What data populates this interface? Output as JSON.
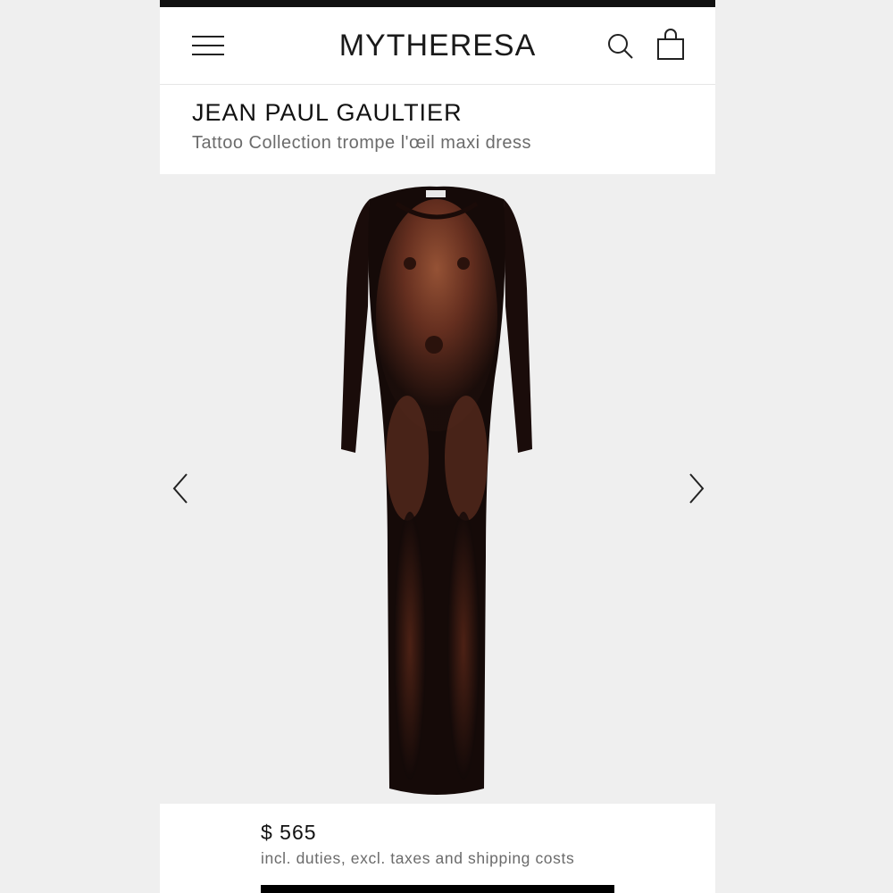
{
  "header": {
    "logo": "MYTHERESA",
    "menu_icon": "hamburger-menu-icon",
    "search_icon": "search-icon",
    "bag_icon": "shopping-bag-icon"
  },
  "product": {
    "brand": "JEAN PAUL GAULTIER",
    "name": "Tattoo Collection trompe l'œil maxi dress",
    "price": "$ 565",
    "price_note": "incl. duties, excl. taxes and shipping costs"
  },
  "gallery": {
    "prev_icon": "chevron-left-icon",
    "next_icon": "chevron-right-icon"
  },
  "colors": {
    "topbar": "#111111",
    "background": "#efefef",
    "secondary_text": "#6b6b6b"
  }
}
